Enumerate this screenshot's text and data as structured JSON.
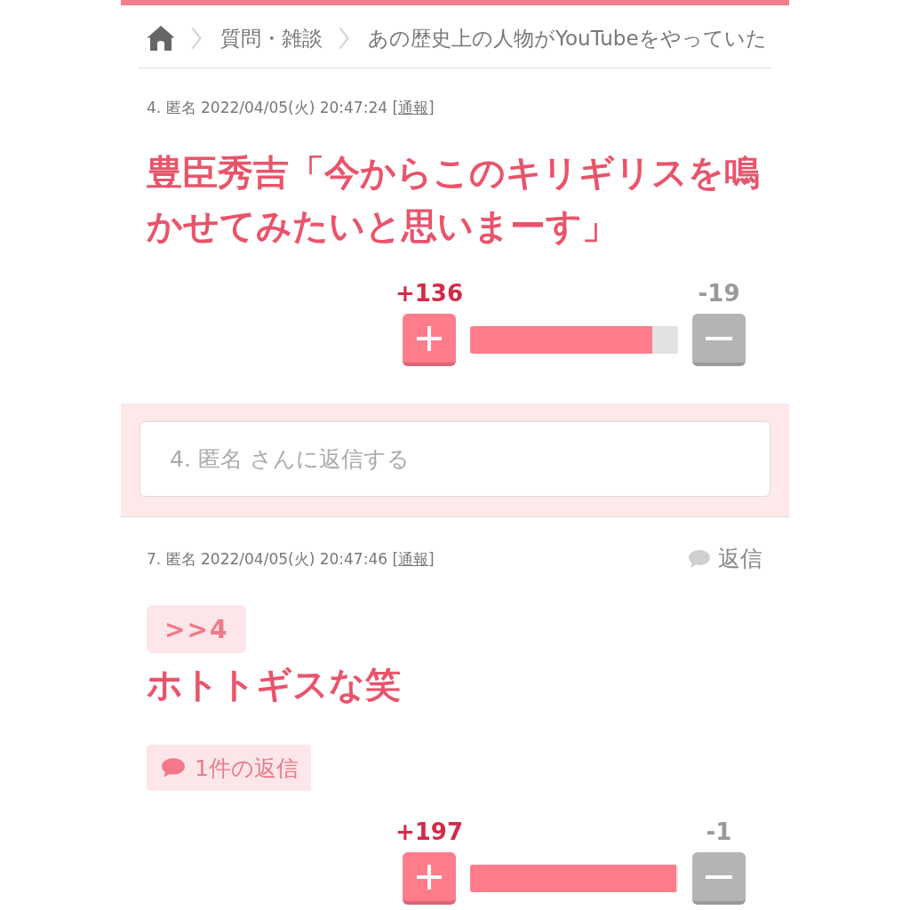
{
  "breadcrumb": {
    "links": [
      "質問・雑談",
      "あの歴史上の人物がYouTubeをやっていた"
    ]
  },
  "posts": [
    {
      "meta": {
        "text": "4. 匿名 2022/04/05(火) 20:47:24 [",
        "report_link": "通報",
        "text_end": "]"
      },
      "body": "豊臣秀吉「今からこのキリギリスを鳴かせてみたいと思いまーす」",
      "votes": {
        "plus": "+136",
        "minus": "-19",
        "level": 0.875
      },
      "reply_form": {
        "placeholder": "4. 匿名 さんに返信する"
      }
    },
    {
      "meta": {
        "text": "7. 匿名 2022/04/05(火) 20:47:46 [",
        "report_link": "通報",
        "text_end": "]"
      },
      "reply_link": "返信",
      "anchor": ">>4",
      "body": "ホトトギスな笑",
      "replies_button": "1件の返信",
      "votes": {
        "plus": "+197",
        "minus": "-1",
        "level": 0.99
      }
    }
  ]
}
